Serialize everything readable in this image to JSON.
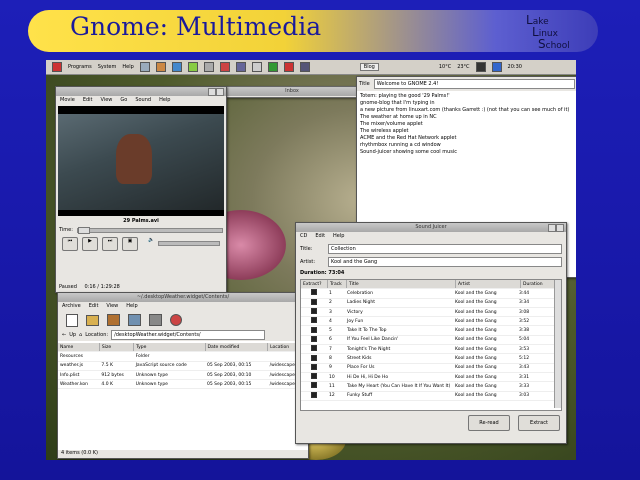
{
  "slide": {
    "title": "Gnome: Multimedia",
    "logo": {
      "line1": "ake",
      "line1_initial": "L",
      "line2": "inux",
      "line2_initial": "L",
      "line3": "chool",
      "line3_initial": "S"
    }
  },
  "panel": {
    "menu_applications": "Programs",
    "menu_system": "System",
    "menu_help": "Help",
    "blog_button": "Blog",
    "weather": "10°C",
    "weather2": "23°C",
    "clock": "20:30"
  },
  "totem": {
    "menu": [
      "Movie",
      "Edit",
      "View",
      "Go",
      "Sound",
      "Help"
    ],
    "filename": "29 Palms.avi",
    "time_label": "Time:",
    "status": "Paused",
    "position": "0:16 / 1:29:28"
  },
  "desktop_window": {
    "title": "Inbox"
  },
  "blog": {
    "title_label": "Title",
    "title_value": "Welcome to GNOME 2.4!",
    "lines": [
      "Totem: playing the good '29 Palms!'",
      "gnome-blog that I'm typing in",
      "a new picture from linuxart.com (thanks Garrett :) (not that you can see much of it)",
      "The weather at home up in NC",
      "The mixer/volume applet",
      "The wireless applet",
      "ACME and the Red Hat Network applet",
      "rhythmbox running a cd window",
      "Sound-juicer showing some cool music"
    ]
  },
  "nautilus": {
    "title": "~/.desktopWeather.widget/Contents/",
    "menu": [
      "Archive",
      "Edit",
      "View",
      "Help"
    ],
    "up_label": "Up",
    "location_label": "Location:",
    "location_value": "/desktopWeather.widget/Contents/",
    "columns": [
      "Name",
      "Size",
      "Type",
      "Date modified",
      "Location"
    ],
    "rows": [
      {
        "name": "Resources",
        "size": "",
        "type": "Folder",
        "date": "",
        "location": ""
      },
      {
        "name": "weather.js",
        "size": "7.5 K",
        "type": "JavaScript source code",
        "date": "05 Sep 2003, 00:15",
        "location": "/widescape"
      },
      {
        "name": "Info.plist",
        "size": "912 bytes",
        "type": "Unknown type",
        "date": "05 Sep 2003, 00:10",
        "location": "/widescape"
      },
      {
        "name": "Weather.kon",
        "size": "4.0 K",
        "type": "Unknown type",
        "date": "05 Sep 2003, 00:15",
        "location": "/widescape"
      }
    ],
    "status": "4 items (0.0 K)"
  },
  "sound_juicer": {
    "title": "Sound Juicer",
    "menu": [
      "CD",
      "Edit",
      "Help"
    ],
    "title_label": "Title:",
    "title_value": "Collection",
    "artist_label": "Artist:",
    "artist_value": "Kool and the Gang",
    "duration_label": "Duration:",
    "duration_value": "73:04",
    "columns": [
      "Extract?",
      "Track",
      "Title",
      "Artist",
      "Duration"
    ],
    "tracks": [
      {
        "n": "1",
        "title": "Celebration",
        "artist": "Kool and the Gang",
        "duration": "3:44"
      },
      {
        "n": "2",
        "title": "Ladies Night",
        "artist": "Kool and the Gang",
        "duration": "3:34"
      },
      {
        "n": "3",
        "title": "Victory",
        "artist": "Kool and the Gang",
        "duration": "3:08"
      },
      {
        "n": "4",
        "title": "Joy Fun",
        "artist": "Kool and the Gang",
        "duration": "3:52"
      },
      {
        "n": "5",
        "title": "Take It To The Top",
        "artist": "Kool and the Gang",
        "duration": "3:38"
      },
      {
        "n": "6",
        "title": "If You Feel Like Dancin'",
        "artist": "Kool and the Gang",
        "duration": "5:04"
      },
      {
        "n": "7",
        "title": "Tonight's The Night",
        "artist": "Kool and the Gang",
        "duration": "3:53"
      },
      {
        "n": "8",
        "title": "Street Kids",
        "artist": "Kool and the Gang",
        "duration": "5:12"
      },
      {
        "n": "9",
        "title": "Place For Us",
        "artist": "Kool and the Gang",
        "duration": "3:43"
      },
      {
        "n": "10",
        "title": "Hi De Hi, Hi De Ho",
        "artist": "Kool and the Gang",
        "duration": "3:31"
      },
      {
        "n": "11",
        "title": "Take My Heart (You Can Have It If You Want It)",
        "artist": "Kool and the Gang",
        "duration": "3:33"
      },
      {
        "n": "12",
        "title": "Funky Stuff",
        "artist": "Kool and the Gang",
        "duration": "3:03"
      }
    ],
    "reread_label": "Re-read",
    "extract_label": "Extract"
  }
}
